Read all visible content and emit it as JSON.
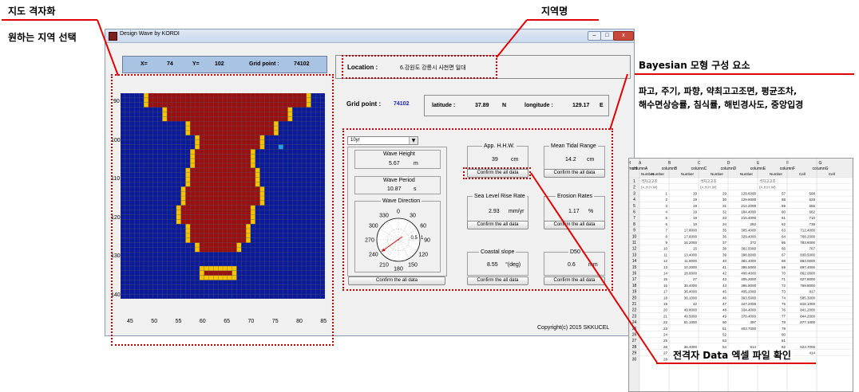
{
  "annotations": {
    "grid_title": "지도 격자화",
    "grid_desc": "원하는 지역 선택",
    "region_name": "지역명",
    "bayesian_title": "Bayesian 모형 구성 요소",
    "bayesian_desc_line1": "파고, 주기, 파향, 약최고고조면, 평균조차,",
    "bayesian_desc_line2": "해수면상승률, 침식률, 해빈경사도, 중앙입경",
    "excel_caption": "전격자 Data 엑셀 파일 확인"
  },
  "window": {
    "title": "Design Wave by KORDI",
    "minimize": "–",
    "maximize": "□",
    "close": "x"
  },
  "coord_bar": {
    "x_label": "X=",
    "x_value": "74",
    "y_label": "Y=",
    "y_value": "102",
    "grid_label": "Grid point :",
    "grid_value": "74102"
  },
  "location": {
    "label": "Location :",
    "value": "6.강원도 강릉시 사천면 일대"
  },
  "gridinfo": {
    "grid_label": "Grid point :",
    "grid_value": "74102",
    "lat_label": "latitude :",
    "lat_value": "37.89",
    "lat_unit": "N",
    "lon_label": "longitude :",
    "lon_value": "129.17",
    "lon_unit": "E"
  },
  "period_select": "10yr",
  "wave_height": {
    "title": "Wave Height",
    "value": "5.67",
    "unit": "m"
  },
  "wave_period": {
    "title": "Wave Period",
    "value": "10.87",
    "unit": "s"
  },
  "wave_direction": {
    "title": "Wave Direction",
    "labels": [
      "0",
      "30",
      "60",
      "90",
      "120",
      "150",
      "180",
      "210",
      "240",
      "270",
      "300",
      "330"
    ],
    "radial": [
      "0.5",
      "1"
    ],
    "arrow_deg": 235
  },
  "confirm_label": "Confirm the all data",
  "app_hhw": {
    "title": "App. H.H.W.",
    "value": "39",
    "unit": "cm"
  },
  "mean_tidal": {
    "title": "Mean Tidal Range",
    "value": "14.2",
    "unit": "cm"
  },
  "sea_level": {
    "title": "Sea Level Rise Rate",
    "value": "2.93",
    "unit": "mm/yr"
  },
  "erosion": {
    "title": "Erosion Rates",
    "value": "1.17",
    "unit": "%"
  },
  "coastal_slope": {
    "title": "Coastal slope",
    "value": "8.55",
    "unit": "°(deg)"
  },
  "d50": {
    "title": "D50",
    "value": "0.6",
    "unit": "mm"
  },
  "copyright": "Copyright(c) 2015 SKKUCEL",
  "map_axes": {
    "x_ticks": [
      "45",
      "50",
      "55",
      "60",
      "65",
      "70",
      "75",
      "80",
      "85"
    ],
    "y_ticks": [
      "90",
      "100",
      "110",
      "120",
      "130",
      "140"
    ]
  },
  "colors": {
    "sea": "#0a1a9a",
    "land": "#9a1010",
    "coast": "#f5c400",
    "grid": "#5e5e5e",
    "highlight": "#1ea0e0"
  },
  "excel": {
    "col_letters": [
      "A",
      "B",
      "C",
      "D",
      "E",
      "F",
      "G",
      "H"
    ],
    "col_names": [
      "columnA",
      "columnB",
      "columnC",
      "columnD",
      "columnE",
      "columnF",
      "columnG",
      "columnH"
    ],
    "col_types": [
      "Number",
      "Number",
      "Number",
      "Number",
      "Number",
      "Number",
      "Cell",
      "Cell"
    ],
    "header_b1": "격자고고조",
    "header_b2": "(A.H.H.W)",
    "header_d1": "격자고고조",
    "header_d2": "(A.H.H.W)",
    "header_f1": "격자고고조",
    "header_f2": "(A.H.H.W)",
    "row_numbers": [
      "1",
      "2",
      "3",
      "4",
      "5",
      "6",
      "7",
      "8",
      "9",
      "10",
      "11",
      "12",
      "13",
      "14",
      "15",
      "16",
      "17",
      "18",
      "19",
      "20",
      "21",
      "22",
      "23",
      "24",
      "25",
      "26",
      "27",
      "28",
      "29",
      "30"
    ],
    "rows": [
      [
        "",
        "",
        "",
        "",
        "",
        "",
        "",
        ""
      ],
      [
        "",
        "",
        "",
        "",
        "",
        "",
        "",
        ""
      ],
      [
        "1",
        "19",
        "29",
        "129.6000",
        "57",
        "598",
        ""
      ],
      [
        "2",
        "19",
        "30",
        "129.6000",
        "58",
        "628",
        ""
      ],
      [
        "3",
        "19",
        "31",
        "214.2000",
        "59",
        "656",
        ""
      ],
      [
        "4",
        "19",
        "32",
        "184.4000",
        "60",
        "682",
        ""
      ],
      [
        "5",
        "19",
        "33",
        "215.4000",
        "61",
        "710",
        ""
      ],
      [
        "6",
        "19",
        "34",
        "282",
        "62",
        "738",
        ""
      ],
      [
        "7",
        "17.8000",
        "35",
        "305.4000",
        "63",
        "712.4000",
        ""
      ],
      [
        "8",
        "17.6000",
        "36",
        "329.4000",
        "64",
        "768.2000",
        ""
      ],
      [
        "9",
        "16.2000",
        "37",
        "372",
        "65",
        "783.6000",
        ""
      ],
      [
        "10",
        "15",
        "38",
        "382.5000",
        "66",
        "767",
        ""
      ],
      [
        "11",
        "13.4000",
        "39",
        "398.8000",
        "67",
        "830.5000",
        ""
      ],
      [
        "12",
        "11.8000",
        "40",
        "381.4000",
        "68",
        "863.0000",
        ""
      ],
      [
        "13",
        "10.2000",
        "41",
        "395.5000",
        "69",
        "897.4000",
        ""
      ],
      [
        "14",
        "28.6000",
        "42",
        "400.4000",
        "70",
        "862.0000",
        ""
      ],
      [
        "15",
        "27",
        "43",
        "405.2000",
        "71",
        "827.8000",
        ""
      ],
      [
        "16",
        "35.4000",
        "44",
        "395.8000",
        "72",
        "769.8000",
        ""
      ],
      [
        "17",
        "36.4000",
        "45",
        "405.2000",
        "73",
        "817",
        ""
      ],
      [
        "18",
        "36.1000",
        "46",
        "393.5000",
        "74",
        "585.3000",
        ""
      ],
      [
        "19",
        "42",
        "47",
        "347.2000",
        "75",
        "818.1000",
        ""
      ],
      [
        "20",
        "49.8000",
        "48",
        "334.4000",
        "76",
        "841.2000",
        ""
      ],
      [
        "21",
        "49.5000",
        "49",
        "370.4000",
        "77",
        "844.2000",
        ""
      ],
      [
        "22",
        "51.1000",
        "50",
        "397",
        "78",
        "877.1000",
        ""
      ],
      [
        "23",
        "",
        "51",
        "403.7000",
        "79",
        "",
        "",
        ""
      ],
      [
        "24",
        "",
        "52",
        "",
        "80",
        "",
        "",
        ""
      ],
      [
        "25",
        "",
        "53",
        "",
        "81",
        "",
        "",
        ""
      ],
      [
        "26",
        "36.4000",
        "54",
        "514",
        "82",
        "523.7000",
        ""
      ],
      [
        "27",
        "102.2000",
        "55",
        "543",
        "83",
        "414",
        ""
      ],
      [
        "28",
        "318",
        "56",
        "570",
        "강동 : 28",
        "",
        ""
      ]
    ]
  }
}
